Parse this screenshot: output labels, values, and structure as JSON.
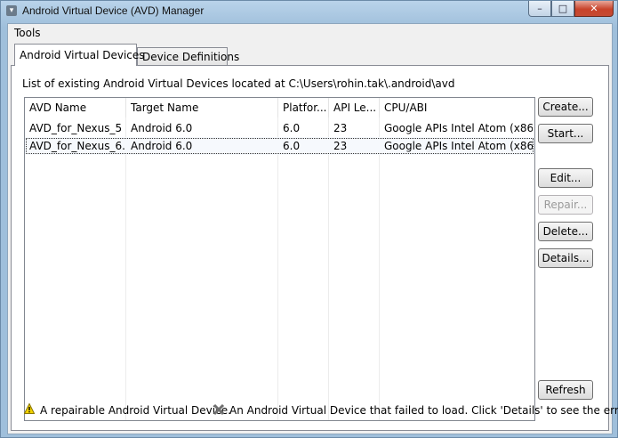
{
  "window": {
    "title": "Android Virtual Device (AVD) Manager",
    "min_symbol": "–",
    "max_symbol": "□",
    "close_symbol": "✕"
  },
  "menubar": {
    "tools_label": "Tools"
  },
  "tabs": [
    {
      "label": "Android Virtual Devices",
      "active": true
    },
    {
      "label": "Device Definitions",
      "active": false
    }
  ],
  "panel": {
    "location_text": "List of existing Android Virtual Devices located at C:\\Users\\rohin.tak\\.android\\avd"
  },
  "table": {
    "columns": [
      "AVD Name",
      "Target Name",
      "Platfor...",
      "API Le...",
      "CPU/ABI"
    ],
    "rows": [
      [
        "AVD_for_Nexus_5",
        "Android 6.0",
        "6.0",
        "23",
        "Google APIs Intel Atom (x86)"
      ],
      [
        "AVD_for_Nexus_6...",
        "Android 6.0",
        "6.0",
        "23",
        "Google APIs Intel Atom (x86)"
      ]
    ],
    "selected_row": 1
  },
  "buttons": {
    "create": "Create...",
    "start": "Start...",
    "edit": "Edit...",
    "repair": "Repair...",
    "delete": "Delete...",
    "details": "Details...",
    "refresh": "Refresh"
  },
  "legend": {
    "warning_icon": "warning-icon",
    "warning_text": "A repairable Android Virtual Device.",
    "error_icon": "x-icon",
    "error_text": "An Android Virtual Device that failed to load. Click 'Details' to see the error."
  },
  "colors": {
    "title_bar": "#a9c7df",
    "close_button": "#c8432b",
    "warning_yellow": "#f2d200"
  }
}
